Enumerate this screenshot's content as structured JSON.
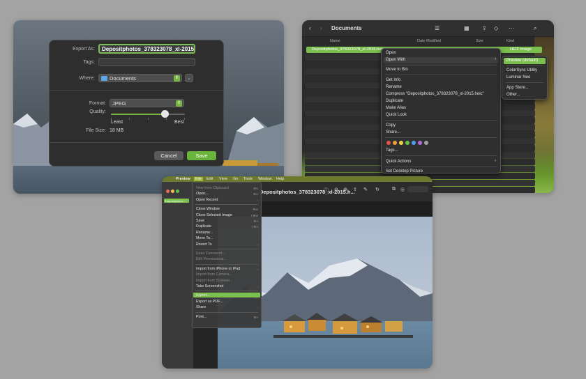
{
  "export_dialog": {
    "export_as_label": "Export As:",
    "export_as_value": "Depositphotos_378323078_xl-2015",
    "tags_label": "Tags:",
    "where_label": "Where:",
    "where_value": "Documents",
    "format_label": "Format:",
    "format_value": "JPEG",
    "quality_label": "Quality:",
    "quality_level": 0.73,
    "least_label": "Least",
    "best_label": "Best",
    "file_size_label": "File Size:",
    "file_size_value": "18 MB",
    "cancel_label": "Cancel",
    "save_label": "Save"
  },
  "finder": {
    "title": "Documents",
    "columns": [
      "Name",
      "Date Modified",
      "Size",
      "Kind"
    ],
    "selected_file": "Depositphotos_378323078_xl-2015.heic",
    "selected_kind": "HEIF Image",
    "context_menu": [
      "Open",
      "Open With",
      "Move to Bin",
      "Get Info",
      "Rename",
      "Compress \"Depositphotos_378323078_xl-2015.heic\"",
      "Duplicate",
      "Make Alias",
      "Quick Look",
      "Copy",
      "Share...",
      "Tags...",
      "Quick Actions",
      "Set Desktop Picture"
    ],
    "open_with_menu": [
      "Preview (default)",
      "ColorSync Utility",
      "Luminar Neo",
      "App Store...",
      "Other..."
    ],
    "tag_colors": [
      "#e0564b",
      "#f0a03a",
      "#f2d34a",
      "#6cc24a",
      "#4f9ff0",
      "#b070d8",
      "#a0a0a0"
    ]
  },
  "preview": {
    "menubar": [
      "Preview",
      "File",
      "Edit",
      "View",
      "Go",
      "Tools",
      "Window",
      "Help"
    ],
    "title": "Depositphotos_378323078_xl-2015.h...",
    "sidebar_item": "Depositphotos...",
    "file_menu": [
      {
        "label": "New from Clipboard",
        "shortcut": "⌘N",
        "disabled": true
      },
      {
        "label": "Open...",
        "shortcut": "⌘O",
        "disabled": false
      },
      {
        "label": "Open Recent",
        "shortcut": "›",
        "disabled": false
      },
      {
        "label": "Close Window",
        "shortcut": "⌘W",
        "disabled": false
      },
      {
        "label": "Close Selected Image",
        "shortcut": "⇧⌘W",
        "disabled": false
      },
      {
        "label": "Save",
        "shortcut": "⌘S",
        "disabled": false
      },
      {
        "label": "Duplicate",
        "shortcut": "⇧⌘S",
        "disabled": false
      },
      {
        "label": "Rename...",
        "shortcut": "",
        "disabled": false
      },
      {
        "label": "Move To...",
        "shortcut": "",
        "disabled": false
      },
      {
        "label": "Revert To",
        "shortcut": "›",
        "disabled": false
      },
      {
        "label": "Enter Password...",
        "shortcut": "",
        "disabled": true
      },
      {
        "label": "Edit Permissions...",
        "shortcut": "",
        "disabled": true
      },
      {
        "label": "Import from iPhone or iPad",
        "shortcut": "›",
        "disabled": false
      },
      {
        "label": "Import from Camera...",
        "shortcut": "",
        "disabled": true
      },
      {
        "label": "Import from Scanner...",
        "shortcut": "",
        "disabled": true
      },
      {
        "label": "Take Screenshot",
        "shortcut": "›",
        "disabled": false
      },
      {
        "label": "Export...",
        "shortcut": "",
        "disabled": false,
        "highlighted": true
      },
      {
        "label": "Export as PDF...",
        "shortcut": "",
        "disabled": false
      },
      {
        "label": "Share",
        "shortcut": "›",
        "disabled": false
      },
      {
        "label": "Print...",
        "shortcut": "⌘P",
        "disabled": false
      }
    ]
  }
}
